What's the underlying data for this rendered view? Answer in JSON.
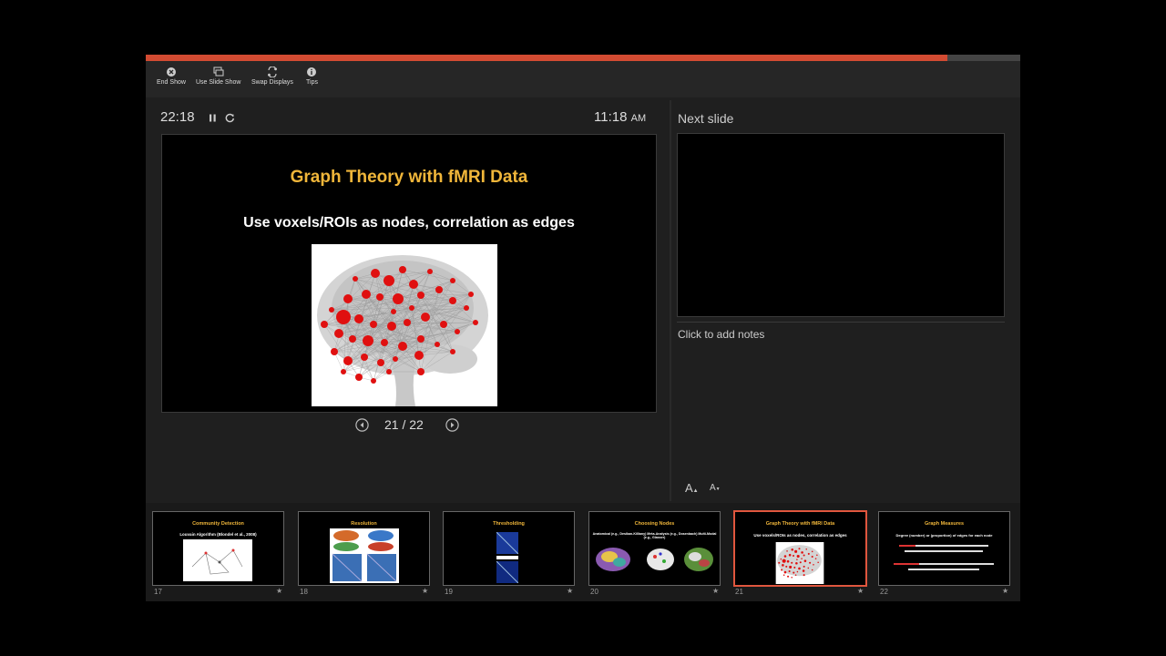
{
  "toolbar": {
    "end_show": "End Show",
    "use_slide_show": "Use Slide Show",
    "swap_displays": "Swap Displays",
    "tips": "Tips"
  },
  "presentation_progress": 0.917,
  "timer": {
    "elapsed": "22:18"
  },
  "clock": {
    "time": "11:18",
    "ampm": "AM"
  },
  "current_slide": {
    "title": "Graph Theory with fMRI Data",
    "subtitle": "Use voxels/ROIs as nodes, correlation as edges"
  },
  "navigation": {
    "counter": "21 / 22"
  },
  "next_slide": {
    "label": "Next slide"
  },
  "notes": {
    "placeholder": "Click to add notes"
  },
  "font_controls": {
    "increase": "A",
    "decrease": "A"
  },
  "filmstrip": [
    {
      "number": "17",
      "title": "Community Detection",
      "text": "Louvain Algorithm (Blondel et al., 2008)"
    },
    {
      "number": "18",
      "title": "Resolution",
      "text": ""
    },
    {
      "number": "19",
      "title": "Thresholding",
      "text": ""
    },
    {
      "number": "20",
      "title": "Choosing Nodes",
      "text": "Anatomical (e.g., Desikan-Killiany)   Meta-Analysis (e.g., Dosenbach)   Multi-Modal (e.g., Glasser)"
    },
    {
      "number": "21",
      "title": "Graph Theory with fMRI Data",
      "text": "Use voxels/ROIs as nodes, correlation as edges"
    },
    {
      "number": "22",
      "title": "Graph Measures",
      "text": "Degree (number) or (proportion) of edges for each node"
    }
  ],
  "colors": {
    "accent": "#d24b32",
    "title": "#f0b63a",
    "node": "#e01010"
  }
}
